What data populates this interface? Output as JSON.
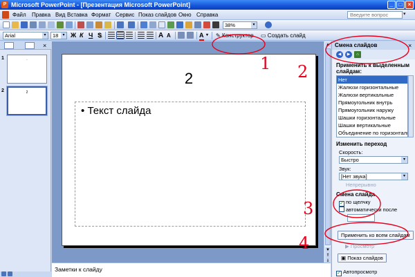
{
  "window": {
    "title": "Microsoft PowerPoint - [Презентация Microsoft PowerPoint]"
  },
  "menu": {
    "items": [
      "Файл",
      "Правка",
      "Вид",
      "Вставка",
      "Формат",
      "Сервис",
      "Показ слайдов",
      "Окно",
      "Справка"
    ],
    "help_placeholder": "Введите вопрос"
  },
  "toolbar": {
    "zoom": "38%",
    "font_name": "Arial",
    "font_size": "18",
    "bold": "Ж",
    "italic": "К",
    "underline": "Ч",
    "shadow": "S",
    "designer_label": "Конструктор",
    "new_slide_label": "Создать слайд"
  },
  "thumbnails": {
    "slides": [
      {
        "number": "1",
        "title": "·"
      },
      {
        "number": "2",
        "title": "2"
      }
    ]
  },
  "slide": {
    "title": "2",
    "body_bullet": "•",
    "body_text": "Текст слайда"
  },
  "notes": {
    "label": "Заметки к слайду"
  },
  "taskpane": {
    "title": "Смена слайдов",
    "apply_header": "Применить к выделенным слайдам:",
    "effects": [
      "Нет",
      "Жалюзи горизонтальные",
      "Жалюзи вертикальные",
      "Прямоугольник внутрь",
      "Прямоугольник наружу",
      "Шашки горизонтальные",
      "Шашки вертикальные",
      "Объединение по горизонтали"
    ],
    "modify_header": "Изменить переход",
    "speed_label": "Скорость:",
    "speed_value": "Быстро",
    "sound_label": "Звук:",
    "sound_value": "[Нет звука]",
    "loop_label": "Непрерывно",
    "advance_header": "Смена слайда",
    "on_click_label": "по щелчку",
    "auto_label": "автоматически после",
    "apply_all_label": "Применить ко всем слайдам",
    "preview_label": "Просмотр",
    "slideshow_label": "Показ слайдов",
    "autopreview_label": "Автопросмотр"
  },
  "annotations": {
    "color": "#e8001c",
    "numbers": [
      "1",
      "2",
      "3",
      "4"
    ]
  }
}
